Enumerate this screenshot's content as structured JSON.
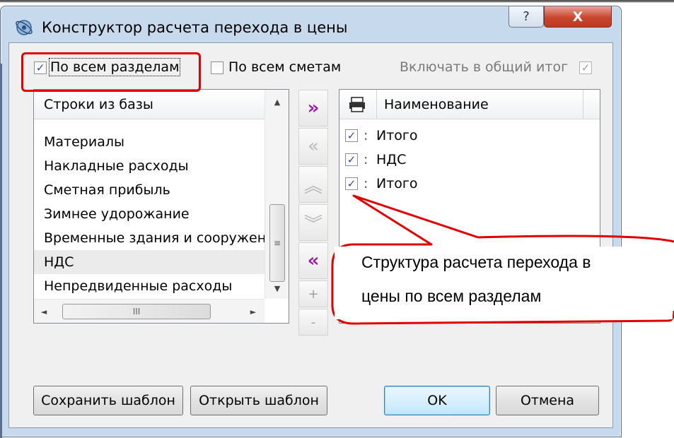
{
  "window": {
    "title": "Конструктор расчета перехода в цены",
    "help_label": "?",
    "close_label": "X"
  },
  "options": {
    "all_sections": {
      "label": "По всем разделам",
      "checked": true
    },
    "all_estimates": {
      "label": "По всем сметам",
      "checked": false
    },
    "include_total": {
      "label": "Включать в общий итог",
      "checked": true,
      "disabled": true
    }
  },
  "left_panel": {
    "header": "Строки из базы",
    "items": [
      "Материалы",
      "Накладные расходы",
      "Сметная прибыль",
      "Зимнее удорожание",
      "Временные здания и сооружения",
      "НДС",
      "Непредвиденные расходы"
    ],
    "selected_index": 5
  },
  "middle_toolbar": {
    "add": "»",
    "remove": "«",
    "move_up": "︽",
    "move_down": "︾",
    "remove_all": "«",
    "plus": "+",
    "minus": "-"
  },
  "right_panel": {
    "header": "Наименование",
    "rows": [
      {
        "sep": ":",
        "name": "Итого",
        "checked": true
      },
      {
        "sep": ":",
        "name": "НДС",
        "checked": true
      },
      {
        "sep": ":",
        "name": "Итого",
        "checked": true
      }
    ]
  },
  "buttons": {
    "save_template": "Сохранить шаблон",
    "open_template": "Открыть шаблон",
    "ok": "OK",
    "cancel": "Отмена"
  },
  "annotation": {
    "line1": "Структура расчета перехода в",
    "line2": "цены по всем разделам",
    "color": "#e00000"
  },
  "scroll": {
    "up": "▲",
    "down": "▼",
    "left": "◄",
    "right": "►",
    "grip": "≡",
    "hgrip": "III"
  }
}
